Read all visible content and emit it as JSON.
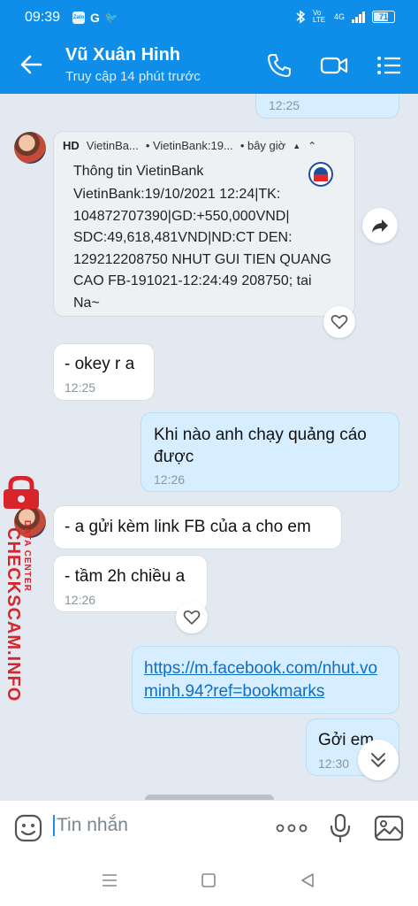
{
  "status_bar": {
    "time": "09:39",
    "app_icons": [
      "Zalo",
      "G",
      "🐦"
    ],
    "network": "Vo LTE",
    "signal_label": "4G",
    "battery": "71",
    "battery_level": 0.71
  },
  "header": {
    "contact_name": "Vũ Xuân Hinh",
    "contact_status": "Truy cập 14 phút trước"
  },
  "messages": {
    "top_out_time": "12:25",
    "card": {
      "badge": "HD",
      "app_name": "VietinBa...",
      "source": "• VietinBank:19...",
      "when": "• bây giờ",
      "title": "Thông tin VietinBank",
      "body": "VietinBank:19/10/2021 12:24|TK: 104872707390|GD:+550,000VND| SDC:49,618,481VND|ND:CT DEN: 129212208750 NHUT GUI TIEN QUANG CAO FB-191021-12:24:49 208750; tai Na~"
    },
    "m1": {
      "text": "- okey r a",
      "time": "12:25"
    },
    "m2": {
      "text": "Khi nào anh chạy quảng cáo được",
      "time": "12:26"
    },
    "m3": {
      "text": "- a gửi kèm link FB của a cho em"
    },
    "m4": {
      "text": "- tầm 2h chiều a",
      "time": "12:26"
    },
    "m5": {
      "text": "https://m.facebook.com/nhut.vominh.94?ref=bookmarks"
    },
    "m6": {
      "text": "Gởi em",
      "time": "12:30"
    }
  },
  "watermark": {
    "main": "CHECKSCAM.INFO",
    "sub": "DATA CENTER"
  },
  "input": {
    "placeholder": "Tin nhắn"
  }
}
